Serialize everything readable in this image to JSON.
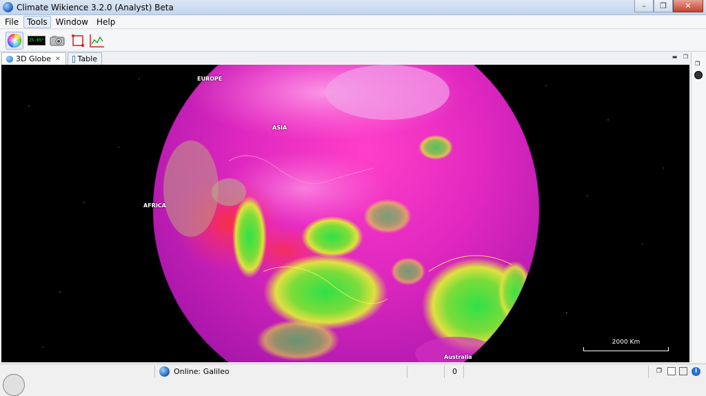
{
  "window": {
    "title": "Climate Wikience 3.2.0 (Analyst) Beta"
  },
  "menu": {
    "items": [
      "File",
      "Tools",
      "Window",
      "Help"
    ]
  },
  "toolbar": {
    "temperature_readout": "25.65°"
  },
  "tabs": [
    {
      "label": "3D Globe"
    },
    {
      "label": "Table"
    }
  ],
  "globe": {
    "labels": {
      "europe": "EUROPE",
      "asia": "ASIA",
      "africa": "AFRICA",
      "australia": "Australia"
    },
    "scale_label": "2000 Km"
  },
  "status": {
    "connection": "Online: Galileo",
    "count": "0"
  },
  "colors": {
    "magenta": "#d11ec8",
    "pink": "#ff3fbf",
    "green": "#38e04a",
    "yellow": "#e8e83a"
  }
}
